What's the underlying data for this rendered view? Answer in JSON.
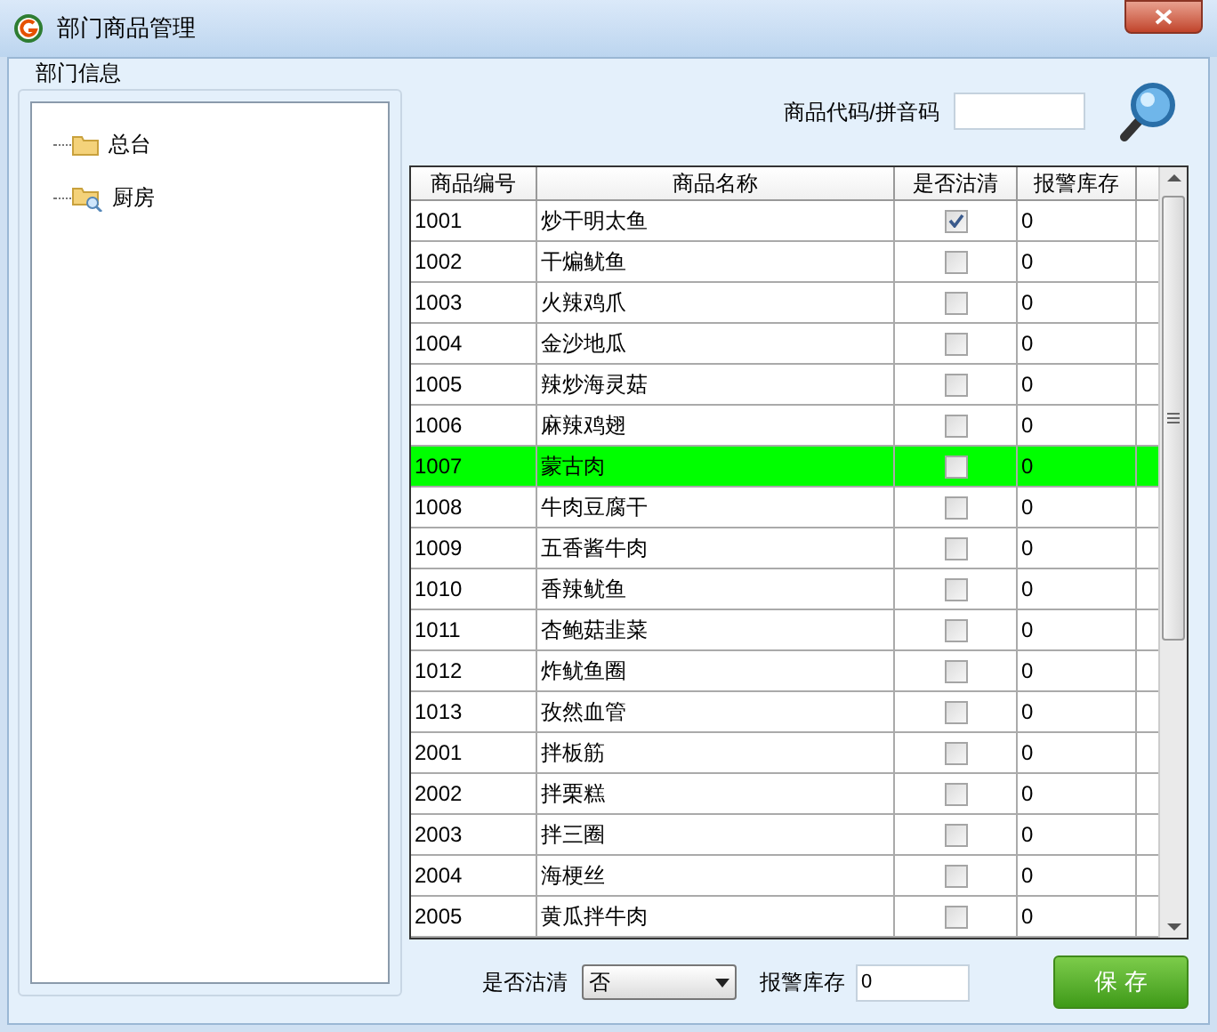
{
  "window": {
    "title": "部门商品管理"
  },
  "department_panel": {
    "title": "部门信息",
    "tree": [
      {
        "label": "总台",
        "kind": "folder",
        "selected": false
      },
      {
        "label": "厨房",
        "kind": "search-folder",
        "selected": false
      }
    ]
  },
  "search": {
    "label": "商品代码/拼音码"
  },
  "table": {
    "columns": [
      "商品编号",
      "商品名称",
      "是否沽清",
      "报警库存"
    ],
    "rows": [
      {
        "code": "1001",
        "name": "炒干明太鱼",
        "checked": true,
        "stock": "0",
        "selected": false
      },
      {
        "code": "1002",
        "name": "干煸鱿鱼",
        "checked": false,
        "stock": "0",
        "selected": false
      },
      {
        "code": "1003",
        "name": "火辣鸡爪",
        "checked": false,
        "stock": "0",
        "selected": false
      },
      {
        "code": "1004",
        "name": "金沙地瓜",
        "checked": false,
        "stock": "0",
        "selected": false
      },
      {
        "code": "1005",
        "name": "辣炒海灵菇",
        "checked": false,
        "stock": "0",
        "selected": false
      },
      {
        "code": "1006",
        "name": "麻辣鸡翅",
        "checked": false,
        "stock": "0",
        "selected": false
      },
      {
        "code": "1007",
        "name": "蒙古肉",
        "checked": false,
        "stock": "0",
        "selected": true
      },
      {
        "code": "1008",
        "name": "牛肉豆腐干",
        "checked": false,
        "stock": "0",
        "selected": false
      },
      {
        "code": "1009",
        "name": "五香酱牛肉",
        "checked": false,
        "stock": "0",
        "selected": false
      },
      {
        "code": "1010",
        "name": "香辣鱿鱼",
        "checked": false,
        "stock": "0",
        "selected": false
      },
      {
        "code": "1011",
        "name": "杏鲍菇韭菜",
        "checked": false,
        "stock": "0",
        "selected": false
      },
      {
        "code": "1012",
        "name": "炸鱿鱼圈",
        "checked": false,
        "stock": "0",
        "selected": false
      },
      {
        "code": "1013",
        "name": "孜然血管",
        "checked": false,
        "stock": "0",
        "selected": false
      },
      {
        "code": "2001",
        "name": "拌板筋",
        "checked": false,
        "stock": "0",
        "selected": false
      },
      {
        "code": "2002",
        "name": "拌栗糕",
        "checked": false,
        "stock": "0",
        "selected": false
      },
      {
        "code": "2003",
        "name": "拌三圈",
        "checked": false,
        "stock": "0",
        "selected": false
      },
      {
        "code": "2004",
        "name": "海梗丝",
        "checked": false,
        "stock": "0",
        "selected": false
      },
      {
        "code": "2005",
        "name": "黄瓜拌牛肉",
        "checked": false,
        "stock": "0",
        "selected": false
      }
    ]
  },
  "editor": {
    "soldout_label": "是否沽清",
    "soldout_value": "否",
    "stock_label": "报警库存",
    "stock_value": "0",
    "save_button": "保 存"
  }
}
